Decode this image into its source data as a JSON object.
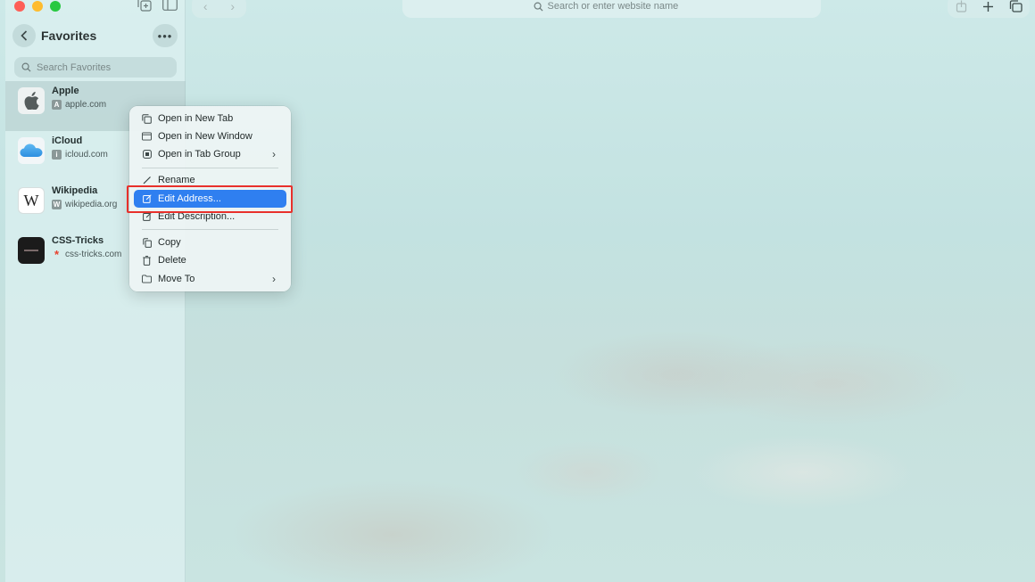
{
  "sidebar": {
    "title": "Favorites",
    "more_label": "•••",
    "search": {
      "placeholder": "Search Favorites"
    },
    "items": [
      {
        "name": "Apple",
        "url": "apple.com",
        "favicon_letter": "A"
      },
      {
        "name": "iCloud",
        "url": "icloud.com",
        "favicon_letter": "i"
      },
      {
        "name": "Wikipedia",
        "url": "wikipedia.org",
        "favicon_letter": "W"
      },
      {
        "name": "CSS-Tricks",
        "url": "css-tricks.com",
        "favicon_letter": "*"
      }
    ]
  },
  "toolbar": {
    "address_placeholder": "Search or enter website name"
  },
  "context_menu": {
    "items": [
      {
        "label": "Open in New Tab",
        "icon": "new-tab-icon"
      },
      {
        "label": "Open in New Window",
        "icon": "new-window-icon"
      },
      {
        "label": "Open in Tab Group",
        "icon": "tab-group-icon",
        "submenu": true
      },
      {
        "label": "Rename",
        "icon": "pencil-icon"
      },
      {
        "label": "Edit Address...",
        "icon": "edit-icon",
        "active": true
      },
      {
        "label": "Edit Description...",
        "icon": "edit-icon"
      },
      {
        "label": "Copy",
        "icon": "copy-icon"
      },
      {
        "label": "Delete",
        "icon": "trash-icon"
      },
      {
        "label": "Move To",
        "icon": "folder-icon",
        "submenu": true
      }
    ]
  },
  "colors": {
    "accent": "#2f7ff0",
    "highlight_border": "#e8302b"
  }
}
